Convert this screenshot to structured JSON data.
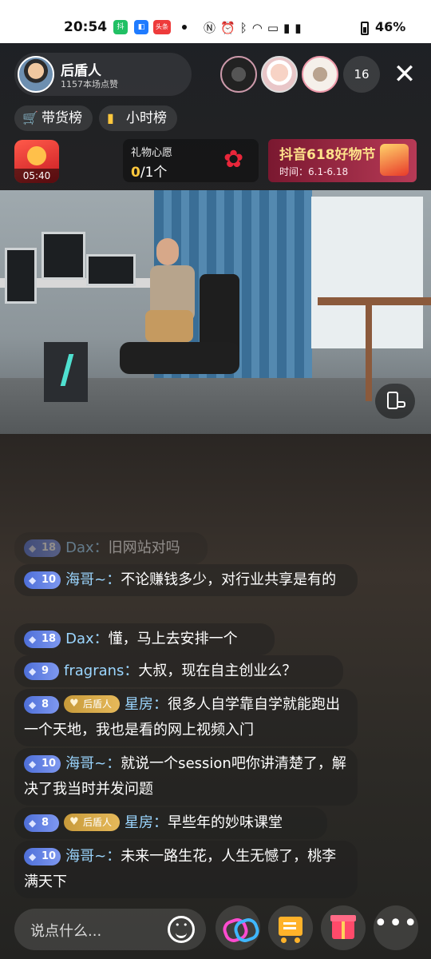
{
  "status_bar": {
    "time": "20:54",
    "battery": "46%",
    "app_icons": [
      {
        "name": "app-icon-green",
        "color": "#21c064",
        "glyph": "抖"
      },
      {
        "name": "app-icon-blue",
        "color": "#1f7bff",
        "glyph": "◧"
      },
      {
        "name": "app-icon-red",
        "color": "#ee3b3b",
        "glyph": "头条"
      }
    ],
    "icons": [
      "nfc-icon",
      "alarm-icon",
      "bluetooth-icon",
      "wifi-icon",
      "hd-icon",
      "signal-5g-icon",
      "signal-3g-icon"
    ]
  },
  "host": {
    "name": "后盾人",
    "likes": "1157本场点赞"
  },
  "viewers": {
    "count": "16"
  },
  "rank": {
    "goods": "带货榜",
    "hourly": "小时榜"
  },
  "red_packet": {
    "timer": "05:40"
  },
  "gift_wish": {
    "title": "礼物心愿",
    "progress_current": "0",
    "progress_total": "/1个",
    "icon": "rose-icon"
  },
  "promo": {
    "title": "抖音618好物节",
    "time": "时间：6.1-6.18"
  },
  "chat": [
    {
      "level": "18",
      "fan": "",
      "nick": "Dax",
      "text": "旧网站对吗",
      "faded": true
    },
    {
      "level": "10",
      "fan": "",
      "nick": "海哥~",
      "text": "不论赚钱多少，对行业共享是有的",
      "faded": false
    },
    {
      "level": "18",
      "fan": "",
      "nick": "Dax",
      "text": "懂，马上去安排一个",
      "faded": false
    },
    {
      "level": "9",
      "fan": "",
      "nick": "fragrans",
      "text": "大叔，现在自主创业么？",
      "faded": false
    },
    {
      "level": "8",
      "fan": "后盾人",
      "nick": "星房",
      "text": "很多人自学靠自学就能跑出一个天地，我也是看的网上视频入门",
      "faded": false
    },
    {
      "level": "10",
      "fan": "",
      "nick": "海哥~",
      "text": "就说一个session吧你讲清楚了，解决了我当时并发问题",
      "faded": false
    },
    {
      "level": "8",
      "fan": "后盾人",
      "nick": "星房",
      "text": "早些年的妙味课堂",
      "faded": false
    },
    {
      "level": "10",
      "fan": "",
      "nick": "海哥~",
      "text": "未来一路生花，人生无憾了，桃李满天下",
      "faded": false
    }
  ],
  "bottom": {
    "input_placeholder": "说点什么...",
    "close_glyph": "✕",
    "more_glyph": "•••"
  },
  "colors": {
    "accent_gold": "#ffc83d",
    "nick_blue": "#9bd6ff",
    "level_blue": "#4e6fd8",
    "fan_gold": "#c79a3a"
  }
}
